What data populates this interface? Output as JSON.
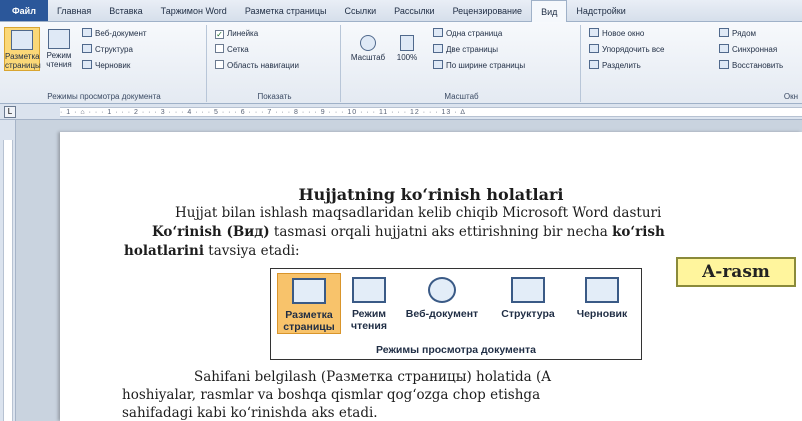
{
  "ribbon": {
    "tabs": [
      {
        "label": "Файл"
      },
      {
        "label": "Главная"
      },
      {
        "label": "Вставка"
      },
      {
        "label": "Таржимон Word"
      },
      {
        "label": "Разметка страницы"
      },
      {
        "label": "Ссылки"
      },
      {
        "label": "Рассылки"
      },
      {
        "label": "Рецензирование"
      },
      {
        "label": "Вид"
      },
      {
        "label": "Надстройки"
      }
    ],
    "active_tab": "Вид",
    "doc_views": {
      "label": "Режимы просмотра документа",
      "layout": "Разметка страницы",
      "reading": "Режим чтения",
      "web": "Веб-документ",
      "outline": "Структура",
      "draft": "Черновик"
    },
    "show": {
      "label": "Показать",
      "ruler": "Линейка",
      "grid": "Сетка",
      "nav_pane": "Область навигации"
    },
    "zoom": {
      "label": "Масштаб",
      "zoom": "Масштаб",
      "percent": "100%",
      "one_page": "Одна страница",
      "two_pages": "Две страницы",
      "page_width": "По ширине страницы"
    },
    "window": {
      "label": "Окн",
      "new_window": "Новое окно",
      "arrange_all": "Упорядочить все",
      "split": "Разделить",
      "side_by_side": "Рядом",
      "sync_scroll": "Синхронная",
      "reset_pos": "Восстановить"
    }
  },
  "ruler": {
    "marks": "· 1 · ⌂ · · · 1 · · · 2 · · · 3 · · · 4 · · · 5 · · · 6 · · · 7 · · · 8 · · · 9 · · · 10 · · · 11 · · · 12 · · · 13 · ∆"
  },
  "document": {
    "title": "Hujjatning ko‘rinish holatlari",
    "p1_line1": "Hujjat bilan ishlash maqsadlaridan kelib chiqib Microsoft Word dasturi",
    "p1_line2_bold1": "Ko‘rinish (Вид)",
    "p1_line2_mid": " tasmasi orqali hujjatni aks ettirishning bir necha ",
    "p1_line2_bold2": "ko‘rish",
    "p1_line3_bold": "holatlarini",
    "p1_line3_rest": " tavsiya etadi:",
    "p2_line1_start": "Sahifani belgilash (Разметка страницы) holatida (A",
    "p2_line2": "hoshiyalar, rasmlar va boshqa qismlar qog‘ozga chop etishga",
    "p2_line3": "sahifadagi kabi ko‘rinishda aks etadi."
  },
  "figure": {
    "layout": "Разметка страницы",
    "reading": "Режим чтения",
    "web": "Веб-документ",
    "outline": "Структура",
    "draft": "Черновик",
    "caption": "Режимы просмотра документа"
  },
  "badge": "A-rasm",
  "colors": {
    "file_tab": "#2b579a",
    "selected": "#f8c36b",
    "badge_bg": "#fff59d"
  }
}
